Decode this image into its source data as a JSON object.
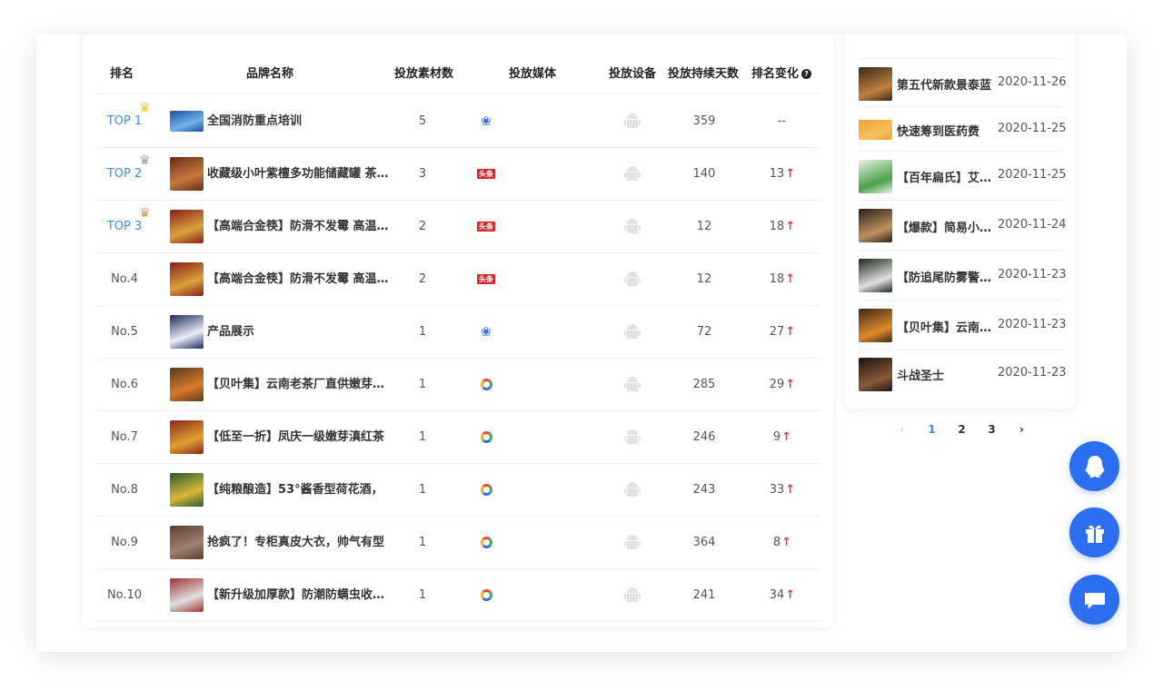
{
  "table": {
    "headers": {
      "rank": "排名",
      "brand": "品牌名称",
      "count": "投放素材数",
      "media": "投放媒体",
      "device": "投放设备",
      "days": "投放持续天数",
      "change": "排名变化"
    },
    "rows": [
      {
        "rank": "TOP 1",
        "name": "全国消防重点培训",
        "count": "5",
        "media": "baidu",
        "days": "359",
        "change": "--",
        "up": ""
      },
      {
        "rank": "TOP 2",
        "name": "收藏级小叶紫檀多功能储藏罐 茶叶罐",
        "count": "3",
        "media": "toutiao",
        "days": "140",
        "change": "13",
        "up": "↑"
      },
      {
        "rank": "TOP 3",
        "name": "【高端合金筷】防滑不发霉 高温消毒",
        "count": "2",
        "media": "toutiao",
        "days": "12",
        "change": "18",
        "up": "↑"
      },
      {
        "rank": "No.4",
        "name": "【高端合金筷】防滑不发霉 高温消毒",
        "count": "2",
        "media": "toutiao",
        "days": "12",
        "change": "18",
        "up": "↑"
      },
      {
        "rank": "No.5",
        "name": "产品展示",
        "count": "1",
        "media": "baidu",
        "days": "72",
        "change": "27",
        "up": "↑"
      },
      {
        "rank": "No.6",
        "name": "【贝叶集】云南老茶厂直供嫩芽滇红",
        "count": "1",
        "media": "ring",
        "days": "285",
        "change": "29",
        "up": "↑"
      },
      {
        "rank": "No.7",
        "name": "【低至一折】凤庆一级嫩芽滇红茶",
        "count": "1",
        "media": "ring",
        "days": "246",
        "change": "9",
        "up": "↑"
      },
      {
        "rank": "No.8",
        "name": "【纯粮酿造】53°酱香型荷花酒，",
        "count": "1",
        "media": "ring",
        "days": "243",
        "change": "33",
        "up": "↑"
      },
      {
        "rank": "No.9",
        "name": "抢疯了！专柜真皮大衣，帅气有型",
        "count": "1",
        "media": "ring",
        "days": "364",
        "change": "8",
        "up": "↑"
      },
      {
        "rank": "No.10",
        "name": "【新升级加厚款】防潮防螨虫收纳袋",
        "count": "1",
        "media": "ring",
        "days": "241",
        "change": "34",
        "up": "↑"
      }
    ]
  },
  "side": {
    "items": [
      {
        "title": "第五代新款景泰蓝",
        "date": "2020-11-26"
      },
      {
        "title": "快速筹到医药费",
        "date": "2020-11-25"
      },
      {
        "title": "【百年扁氏】艾草贴",
        "date": "2020-11-25"
      },
      {
        "title": "【爆款】简易小书架",
        "date": "2020-11-24"
      },
      {
        "title": "【防追尾防雾警示灯",
        "date": "2020-11-23"
      },
      {
        "title": "【贝叶集】云南老茶",
        "date": "2020-11-23"
      },
      {
        "title": "斗战圣士",
        "date": "2020-11-23"
      }
    ]
  },
  "pager": {
    "prev": "‹",
    "pages": [
      "1",
      "2",
      "3"
    ],
    "next": "›",
    "current": "1"
  },
  "icons": {
    "help": "?",
    "crown": "♛",
    "paw": "❀"
  },
  "colors": {
    "accent": "#2b6ef0",
    "link": "#3a8ee6",
    "up": "#e23c3c"
  }
}
